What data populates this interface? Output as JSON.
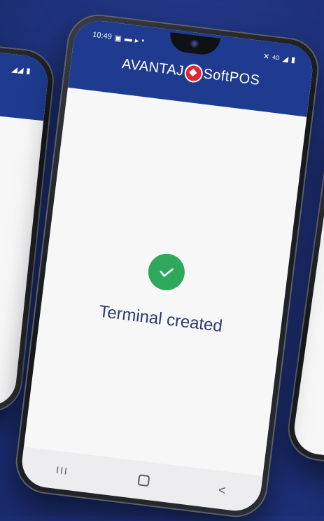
{
  "status_bar": {
    "time": "10:49",
    "left_icons": [
      "gallery-icon",
      "chat-icon",
      "play-icon"
    ],
    "right_text": "4G"
  },
  "app_header": {
    "brand_left": "AVANTAJ",
    "brand_right": "SoftPOS"
  },
  "main": {
    "status_icon": "check-icon",
    "message": "Terminal created"
  },
  "nav_bar": {
    "recent_label": "III",
    "back_label": "<"
  },
  "colors": {
    "background": "#23398a",
    "app_bar": "#1f3b8f",
    "success": "#2ea85c",
    "brand_red": "#e32634",
    "message_text": "#2b3b6e"
  }
}
